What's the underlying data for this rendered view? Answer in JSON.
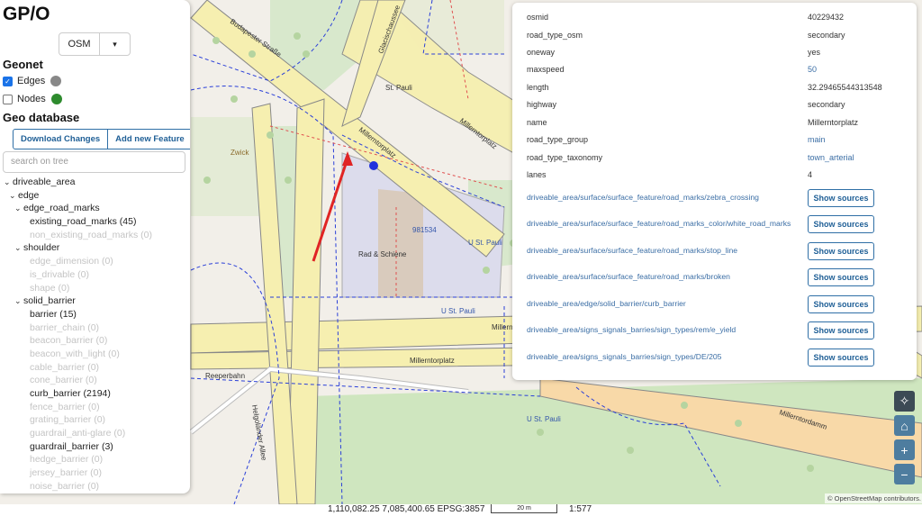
{
  "app": {
    "title": "GP/O"
  },
  "basemap": {
    "value": "OSM",
    "chevron": "▾"
  },
  "geonet": {
    "title": "Geonet",
    "layers": [
      {
        "label": "Edges",
        "checked": true,
        "color": "#888888"
      },
      {
        "label": "Nodes",
        "checked": false,
        "color": "#2e8b2e"
      }
    ]
  },
  "geodb": {
    "title": "Geo database",
    "download_label": "Download Changes",
    "add_label": "Add new Feature",
    "search_placeholder": "search on tree"
  },
  "tree": [
    {
      "label": "driveable_area",
      "toggle": "⌄",
      "dim": false
    },
    {
      "label": "edge",
      "toggle": "⌄",
      "dim": false
    },
    {
      "label": "edge_road_marks",
      "toggle": "⌄",
      "dim": false
    },
    {
      "label": "existing_road_marks (45)",
      "toggle": "",
      "dim": false
    },
    {
      "label": "non_existing_road_marks (0)",
      "toggle": "",
      "dim": true
    },
    {
      "label": "shoulder",
      "toggle": "⌄",
      "dim": false
    },
    {
      "label": "edge_dimension (0)",
      "toggle": "",
      "dim": true
    },
    {
      "label": "is_drivable (0)",
      "toggle": "",
      "dim": true
    },
    {
      "label": "shape (0)",
      "toggle": "",
      "dim": true
    },
    {
      "label": "solid_barrier",
      "toggle": "⌄",
      "dim": false
    },
    {
      "label": "barrier (15)",
      "toggle": "",
      "dim": false
    },
    {
      "label": "barrier_chain (0)",
      "toggle": "",
      "dim": true
    },
    {
      "label": "beacon_barrier (0)",
      "toggle": "",
      "dim": true
    },
    {
      "label": "beacon_with_light (0)",
      "toggle": "",
      "dim": true
    },
    {
      "label": "cable_barrier (0)",
      "toggle": "",
      "dim": true
    },
    {
      "label": "cone_barrier (0)",
      "toggle": "",
      "dim": true
    },
    {
      "label": "curb_barrier (2194)",
      "toggle": "",
      "dim": false
    },
    {
      "label": "fence_barrier (0)",
      "toggle": "",
      "dim": true
    },
    {
      "label": "grating_barrier (0)",
      "toggle": "",
      "dim": true
    },
    {
      "label": "guardrail_anti-glare (0)",
      "toggle": "",
      "dim": true
    },
    {
      "label": "guardrail_barrier (3)",
      "toggle": "",
      "dim": false
    },
    {
      "label": "hedge_barrier (0)",
      "toggle": "",
      "dim": true
    },
    {
      "label": "jersey_barrier (0)",
      "toggle": "",
      "dim": true
    },
    {
      "label": "noise_barrier (0)",
      "toggle": "",
      "dim": true
    }
  ],
  "properties": [
    {
      "key": "osmid",
      "value": "40229432",
      "link": false
    },
    {
      "key": "road_type_osm",
      "value": "secondary",
      "link": false
    },
    {
      "key": "oneway",
      "value": "yes",
      "link": false
    },
    {
      "key": "maxspeed",
      "value": "50",
      "link": true
    },
    {
      "key": "length",
      "value": "32.29465544313548",
      "link": false
    },
    {
      "key": "highway",
      "value": "secondary",
      "link": false
    },
    {
      "key": "name",
      "value": "Millerntorplatz",
      "link": false
    },
    {
      "key": "road_type_group",
      "value": "main",
      "link": true
    },
    {
      "key": "road_type_taxonomy",
      "value": "town_arterial",
      "link": true
    },
    {
      "key": "lanes",
      "value": "4",
      "link": false
    }
  ],
  "sources": [
    {
      "path": "driveable_area/surface/surface_feature/road_marks/zebra_crossing",
      "button": "Show sources"
    },
    {
      "path": "driveable_area/surface/surface_feature/road_marks_color/white_road_marks",
      "button": "Show sources"
    },
    {
      "path": "driveable_area/surface/surface_feature/road_marks/stop_line",
      "button": "Show sources"
    },
    {
      "path": "driveable_area/surface/surface_feature/road_marks/broken",
      "button": "Show sources"
    },
    {
      "path": "driveable_area/edge/solid_barrier/curb_barrier",
      "button": "Show sources"
    },
    {
      "path": "driveable_area/signs_signals_barries/sign_types/rem/e_yield",
      "button": "Show sources"
    },
    {
      "path": "driveable_area/signs_signals_barries/sign_types/DE/205",
      "button": "Show sources"
    }
  ],
  "map_labels": {
    "st_pauli": "St. Pauli",
    "millerntorplatz": "Millerntorplatz",
    "millerntordamm": "Millerntordamm",
    "reeperbahn": "Reeperbahn",
    "glacischaussee": "Glacischaussee",
    "budapester": "Budapester Straße",
    "helgolaender": "Helgoländer Allee",
    "rad_schiene": "Rad & Schiene",
    "u_st_pauli": "U St. Pauli",
    "zwick": "Zwick",
    "stop_num": "981534",
    "millern": "Millern"
  },
  "controls": {
    "locate": "✧",
    "home": "⌂",
    "zoom_in": "+",
    "zoom_out": "−"
  },
  "attribution": "© OpenStreetMap contributors.",
  "status": {
    "coords": "1,110,082.25 7,085,400.65 EPSG:3857",
    "scale_label": "20 m",
    "ratio": "1:577"
  }
}
